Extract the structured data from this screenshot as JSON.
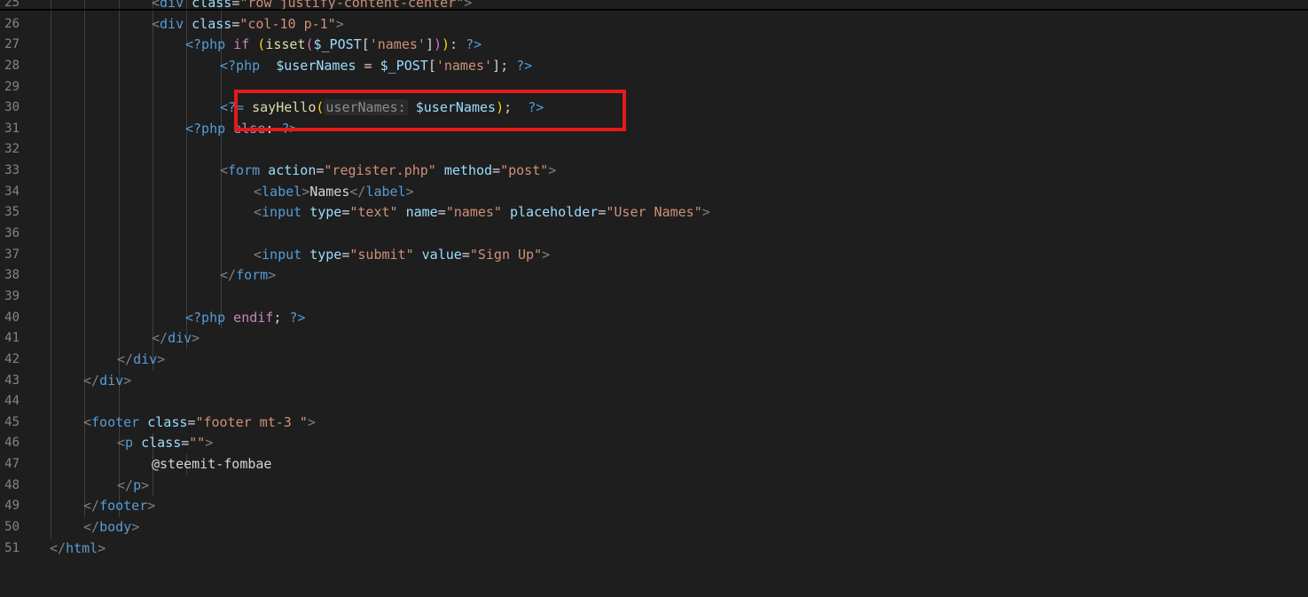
{
  "editor": {
    "language": "php",
    "theme_colors": {
      "background": "#1e1e1e",
      "line_number": "#858585",
      "tag": "#569cd6",
      "attribute": "#9cdcfe",
      "string": "#ce9178",
      "keyword": "#c586c0",
      "function": "#dcdcaa",
      "highlight_box": "#e31b1b"
    },
    "lines": [
      {
        "n": "25",
        "tokens": [
          [
            "tg",
            "<"
          ],
          [
            "tn",
            "div"
          ],
          [
            "at",
            " class"
          ],
          [
            "tx",
            "="
          ],
          [
            "st",
            "\"row justify-content-center\""
          ],
          [
            "tg",
            ">"
          ]
        ]
      },
      {
        "n": "26",
        "tokens": [
          [
            "tg",
            "<"
          ],
          [
            "tn",
            "div"
          ],
          [
            "at",
            " class"
          ],
          [
            "tx",
            "="
          ],
          [
            "st",
            "\"col-10 p-1\""
          ],
          [
            "tg",
            ">"
          ]
        ]
      },
      {
        "n": "27",
        "tokens": [
          [
            "ph",
            "<?php"
          ],
          [
            "kw",
            " if "
          ],
          [
            "br",
            "("
          ],
          [
            "fn",
            "isset"
          ],
          [
            "br2",
            "("
          ],
          [
            "vr",
            "$_POST"
          ],
          [
            "tx",
            "["
          ],
          [
            "st",
            "'names'"
          ],
          [
            "tx",
            "]"
          ],
          [
            "br2",
            ")"
          ],
          [
            "br",
            ")"
          ],
          [
            "tx",
            ": "
          ],
          [
            "ph",
            "?>"
          ]
        ]
      },
      {
        "n": "28",
        "tokens": [
          [
            "ph",
            "<?php"
          ],
          [
            "vr",
            "  $userNames"
          ],
          [
            "tx",
            " = "
          ],
          [
            "vr",
            "$_POST"
          ],
          [
            "tx",
            "["
          ],
          [
            "st",
            "'names'"
          ],
          [
            "tx",
            "]; "
          ],
          [
            "ph",
            "?>"
          ]
        ]
      },
      {
        "n": "29",
        "tokens": []
      },
      {
        "n": "30",
        "tokens": [
          [
            "ph",
            "<?="
          ],
          [
            "fn",
            " sayHello"
          ],
          [
            "br",
            "("
          ],
          [
            "hint",
            "userNames:"
          ],
          [
            "vr",
            " $userNames"
          ],
          [
            "br",
            ")"
          ],
          [
            "tx",
            ";  "
          ],
          [
            "ph",
            "?>"
          ]
        ]
      },
      {
        "n": "31",
        "tokens": [
          [
            "ph",
            "<?php"
          ],
          [
            "kw",
            " else"
          ],
          [
            "tx",
            ": "
          ],
          [
            "ph",
            "?>"
          ]
        ]
      },
      {
        "n": "32",
        "tokens": []
      },
      {
        "n": "33",
        "tokens": [
          [
            "tg",
            "<"
          ],
          [
            "tn",
            "form"
          ],
          [
            "at",
            " action"
          ],
          [
            "tx",
            "="
          ],
          [
            "st",
            "\"register.php\""
          ],
          [
            "at",
            " method"
          ],
          [
            "tx",
            "="
          ],
          [
            "st",
            "\"post\""
          ],
          [
            "tg",
            ">"
          ]
        ]
      },
      {
        "n": "34",
        "tokens": [
          [
            "tg",
            "<"
          ],
          [
            "tn",
            "label"
          ],
          [
            "tg",
            ">"
          ],
          [
            "tx",
            "Names"
          ],
          [
            "tg",
            "</"
          ],
          [
            "tn",
            "label"
          ],
          [
            "tg",
            ">"
          ]
        ]
      },
      {
        "n": "35",
        "tokens": [
          [
            "tg",
            "<"
          ],
          [
            "tn",
            "input"
          ],
          [
            "at",
            " type"
          ],
          [
            "tx",
            "="
          ],
          [
            "st",
            "\"text\""
          ],
          [
            "at",
            " name"
          ],
          [
            "tx",
            "="
          ],
          [
            "st",
            "\"names\""
          ],
          [
            "at",
            " placeholder"
          ],
          [
            "tx",
            "="
          ],
          [
            "st",
            "\"User Names\""
          ],
          [
            "tg",
            ">"
          ]
        ]
      },
      {
        "n": "36",
        "tokens": []
      },
      {
        "n": "37",
        "tokens": [
          [
            "tg",
            "<"
          ],
          [
            "tn",
            "input"
          ],
          [
            "at",
            " type"
          ],
          [
            "tx",
            "="
          ],
          [
            "st",
            "\"submit\""
          ],
          [
            "at",
            " value"
          ],
          [
            "tx",
            "="
          ],
          [
            "st",
            "\"Sign Up\""
          ],
          [
            "tg",
            ">"
          ]
        ]
      },
      {
        "n": "38",
        "tokens": [
          [
            "tg",
            "</"
          ],
          [
            "tn",
            "form"
          ],
          [
            "tg",
            ">"
          ]
        ]
      },
      {
        "n": "39",
        "tokens": []
      },
      {
        "n": "40",
        "tokens": [
          [
            "ph",
            "<?php"
          ],
          [
            "kw",
            " endif"
          ],
          [
            "tx",
            "; "
          ],
          [
            "ph",
            "?>"
          ]
        ]
      },
      {
        "n": "41",
        "tokens": [
          [
            "tg",
            "</"
          ],
          [
            "tn",
            "div"
          ],
          [
            "tg",
            ">"
          ]
        ]
      },
      {
        "n": "42",
        "tokens": [
          [
            "tg",
            "</"
          ],
          [
            "tn",
            "div"
          ],
          [
            "tg",
            ">"
          ]
        ]
      },
      {
        "n": "43",
        "tokens": [
          [
            "tg",
            "</"
          ],
          [
            "tn",
            "div"
          ],
          [
            "tg",
            ">"
          ]
        ]
      },
      {
        "n": "44",
        "tokens": []
      },
      {
        "n": "45",
        "tokens": [
          [
            "tg",
            "<"
          ],
          [
            "tn",
            "footer"
          ],
          [
            "at",
            " class"
          ],
          [
            "tx",
            "="
          ],
          [
            "st",
            "\"footer mt-3 \""
          ],
          [
            "tg",
            ">"
          ]
        ]
      },
      {
        "n": "46",
        "tokens": [
          [
            "tg",
            "<"
          ],
          [
            "tn",
            "p"
          ],
          [
            "at",
            " class"
          ],
          [
            "tx",
            "="
          ],
          [
            "st",
            "\"\""
          ],
          [
            "tg",
            ">"
          ]
        ]
      },
      {
        "n": "47",
        "tokens": [
          [
            "tx",
            "@steemit-fombae"
          ]
        ]
      },
      {
        "n": "48",
        "tokens": [
          [
            "tg",
            "</"
          ],
          [
            "tn",
            "p"
          ],
          [
            "tg",
            ">"
          ]
        ]
      },
      {
        "n": "49",
        "tokens": [
          [
            "tg",
            "</"
          ],
          [
            "tn",
            "footer"
          ],
          [
            "tg",
            ">"
          ]
        ]
      },
      {
        "n": "50",
        "tokens": [
          [
            "tg",
            "</"
          ],
          [
            "tn",
            "body"
          ],
          [
            "tg",
            ">"
          ]
        ]
      },
      {
        "n": "51",
        "tokens": [
          [
            "tg",
            "</"
          ],
          [
            "tn",
            "html"
          ],
          [
            "tg",
            ">"
          ]
        ]
      }
    ]
  }
}
